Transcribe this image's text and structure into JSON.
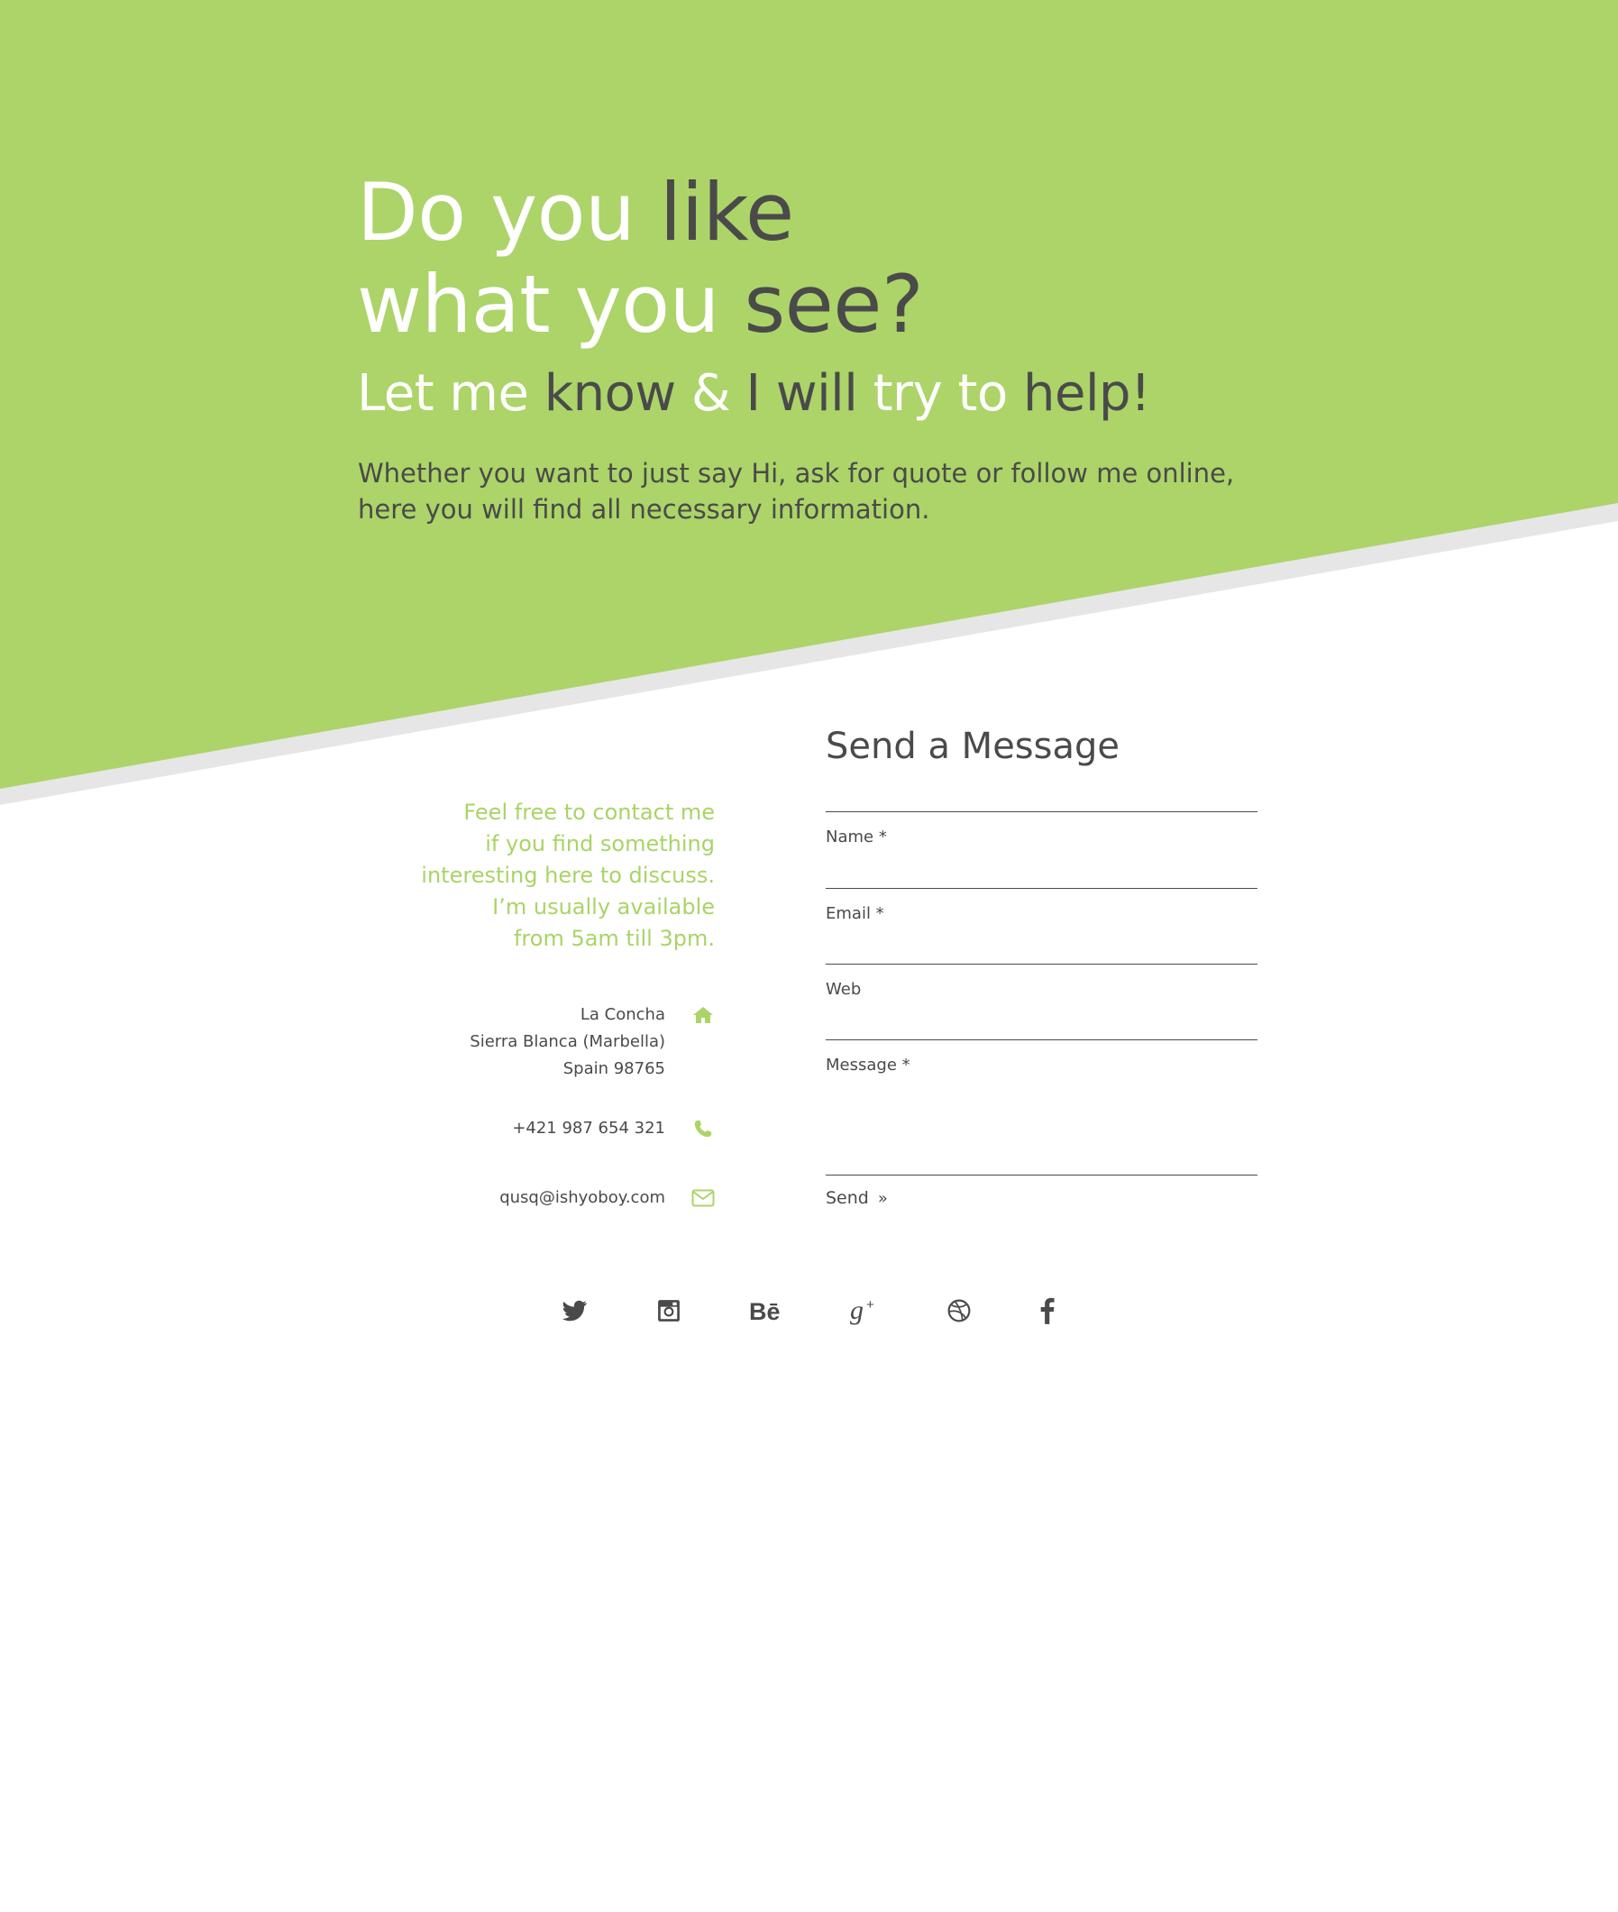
{
  "hero": {
    "title_line1_light": "Do you ",
    "title_line1_dark": "like",
    "title_line2_light": "what you ",
    "title_line2_dark": "see?",
    "subtitle_light_1": "Let me ",
    "subtitle_dark_1": "know",
    "subtitle_light_2": " & ",
    "subtitle_dark_2": "I will",
    "subtitle_light_3": " try to ",
    "subtitle_dark_3": "help!",
    "text_line1": "Whether you want to just say Hi, ask for quote or follow me online,",
    "text_line2": "here you will find all necessary information."
  },
  "contact": {
    "intro_lines": [
      "Feel free to contact me",
      "if you find something",
      "interesting here to discuss.",
      "I’m usually available",
      "from 5am till 3pm."
    ],
    "address": [
      "La Concha",
      "Sierra Blanca (Marbella)",
      "Spain 98765"
    ],
    "address_icon": "home-icon",
    "phone": "+421 987 654 321",
    "phone_icon": "phone-icon",
    "email": "qusq@ishyoboy.com",
    "email_icon": "envelope-icon"
  },
  "form": {
    "title": "Send a Message",
    "name_label": "Name *",
    "email_label": "Email *",
    "web_label": "Web",
    "message_label": "Message *",
    "send_label": "Send",
    "send_icon": "double-chevron-right-icon"
  },
  "social": [
    "twitter-icon",
    "instagram-icon",
    "behance-icon",
    "google-plus-icon",
    "dribbble-icon",
    "facebook-icon"
  ],
  "colors": {
    "accent": "#acd468",
    "text_dark": "#4a4a4a",
    "shadow_band": "#e6e6e6",
    "background": "#ffffff"
  }
}
